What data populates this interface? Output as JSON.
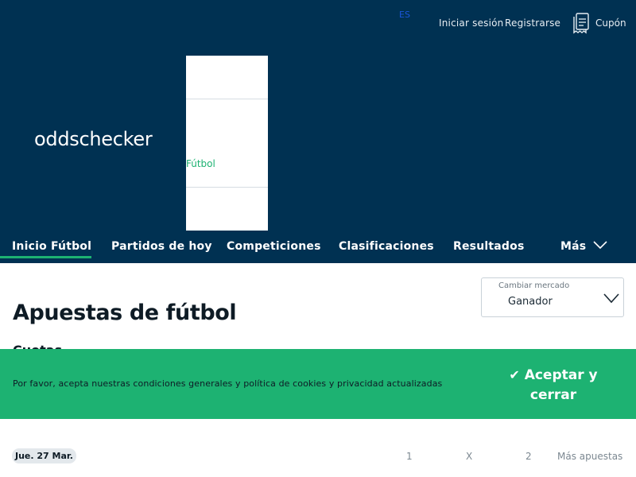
{
  "header": {
    "language": "ES",
    "login_label": "Iniciar sesión",
    "register_label": "Registrarse",
    "coupon_label": "Cupón",
    "logo_text": "oddschecker"
  },
  "sport_dropdown": {
    "items": [
      "Fútbol"
    ]
  },
  "nav": {
    "items": [
      {
        "label": "Inicio Fútbol",
        "active": true
      },
      {
        "label": "Partidos de hoy"
      },
      {
        "label": "Competiciones"
      },
      {
        "label": "Clasificaciones"
      },
      {
        "label": "Resultados"
      },
      {
        "label": "Más"
      }
    ]
  },
  "market_selector": {
    "caption": "Cambiar mercado",
    "value": "Ganador"
  },
  "main": {
    "title": "Apuestas de fútbol",
    "subtitle_partial": "Cuotas"
  },
  "cookie_banner": {
    "text": "Por favor, acepta nuestras condiciones generales y política de cookies y privacidad actualizadas",
    "accept_label_line1": "Aceptar y",
    "accept_label_line2": "cerrar"
  },
  "fixtures": {
    "date_label": "Jue. 27 Mar.",
    "columns": [
      "1",
      "X",
      "2",
      "Más apuestas"
    ]
  },
  "colors": {
    "header_bg": "#003152",
    "accent_green": "#1db272",
    "text_dark": "#0e1b25"
  }
}
